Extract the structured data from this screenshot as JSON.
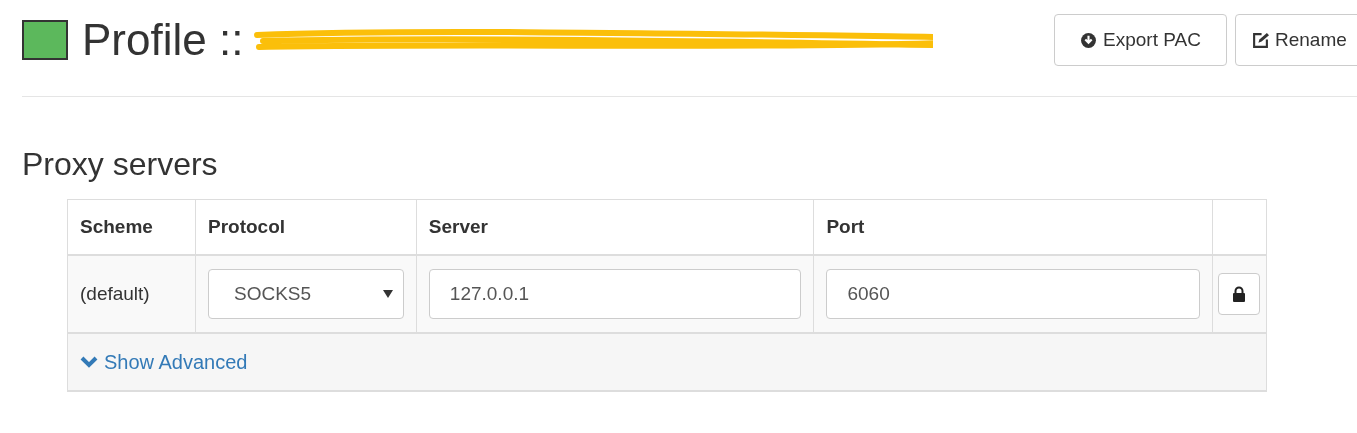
{
  "header": {
    "title": "Profile ::",
    "color": "#5cb85c",
    "buttons": [
      {
        "label": "Export PAC"
      },
      {
        "label": "Rename"
      }
    ]
  },
  "section": {
    "title": "Proxy servers"
  },
  "table": {
    "columns": [
      "Scheme",
      "Protocol",
      "Server",
      "Port"
    ],
    "rows": [
      {
        "scheme": "(default)",
        "protocol": "SOCKS5",
        "server": "127.0.0.1",
        "port": "6060"
      }
    ],
    "footer_link": "Show Advanced"
  }
}
